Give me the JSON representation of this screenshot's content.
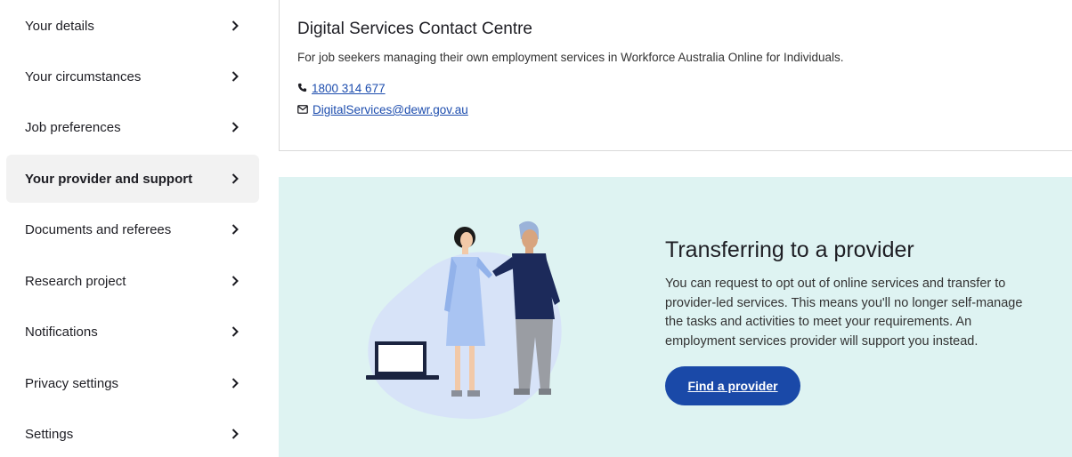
{
  "sidebar": {
    "items": [
      {
        "label": "Your details"
      },
      {
        "label": "Your circumstances"
      },
      {
        "label": "Job preferences"
      },
      {
        "label": "Your provider and support"
      },
      {
        "label": "Documents and referees"
      },
      {
        "label": "Research project"
      },
      {
        "label": "Notifications"
      },
      {
        "label": "Privacy settings"
      },
      {
        "label": "Settings"
      }
    ],
    "active_label": "Your provider and support"
  },
  "contact": {
    "title": "Digital Services Contact Centre",
    "subtitle": "For job seekers managing their own employment services in Workforce Australia Online for Individuals.",
    "phone": "1800 314 677",
    "email": "DigitalServices@dewr.gov.au"
  },
  "banner": {
    "title": "Transferring to a provider",
    "body": "You can request to opt out of online services and transfer to provider-led services. This means you'll no longer self-manage the tasks and activities to meet your requirements. An employment services provider will support you instead.",
    "button_label": "Find a provider"
  },
  "colors": {
    "accent": "#1a49a8",
    "link": "#1d4dae",
    "banner_bg": "#def3f2",
    "active_bg": "#f2f2f2"
  },
  "icons": {
    "chevron": "chevron-right-icon",
    "phone": "phone-icon",
    "email": "mail-icon"
  }
}
